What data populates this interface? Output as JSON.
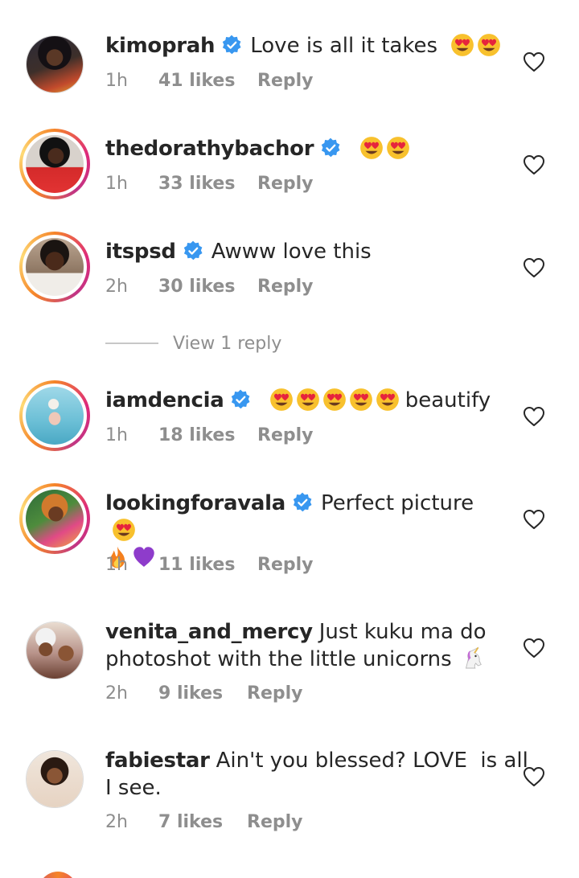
{
  "colors": {
    "verified": "#3897f0",
    "meta": "#8e8e8e",
    "ring_start": "#f58529",
    "ring_end": "#dd2a7b"
  },
  "comments": [
    {
      "username": "kimoprah",
      "verified": true,
      "text": "Love is all it takes",
      "emoji_after": [
        "heart-eyes",
        "heart-eyes"
      ],
      "time": "1h",
      "likes": "41 likes",
      "reply": "Reply",
      "story_ring": false
    },
    {
      "username": "thedorathybachor",
      "verified": true,
      "text": "",
      "emoji_after": [
        "heart-eyes",
        "heart-eyes"
      ],
      "time": "1h",
      "likes": "33 likes",
      "reply": "Reply",
      "story_ring": true
    },
    {
      "username": "itspsd",
      "verified": true,
      "text": "Awww love this",
      "emoji_after": [],
      "time": "2h",
      "likes": "30 likes",
      "reply": "Reply",
      "story_ring": true
    },
    {
      "username": "iamdencia",
      "verified": true,
      "text": "beautify",
      "emoji_before": [
        "heart-eyes",
        "heart-eyes",
        "heart-eyes",
        "heart-eyes",
        "heart-eyes"
      ],
      "time": "1h",
      "likes": "18 likes",
      "reply": "Reply",
      "story_ring": true
    },
    {
      "username": "lookingforavala",
      "verified": true,
      "text": "Perfect picture",
      "emoji_after": [
        "heart-eyes"
      ],
      "emoji_line2": [
        "fire",
        "purple-heart"
      ],
      "time": "1h",
      "likes": "11 likes",
      "reply": "Reply",
      "story_ring": true
    },
    {
      "username": "venita_and_mercy",
      "verified": false,
      "text": "Just kuku ma do",
      "text_line2": "photoshot with the little unicorns",
      "emoji_line2_after": [
        "unicorn"
      ],
      "time": "2h",
      "likes": "9 likes",
      "reply": "Reply",
      "story_ring": false
    },
    {
      "username": "fabiestar",
      "verified": false,
      "text": "Ain't you blessed? LOVE  is all",
      "text_line2": "I see.",
      "time": "2h",
      "likes": "7 likes",
      "reply": "Reply",
      "story_ring": false
    }
  ],
  "view_replies": {
    "label": "View 1 reply"
  }
}
